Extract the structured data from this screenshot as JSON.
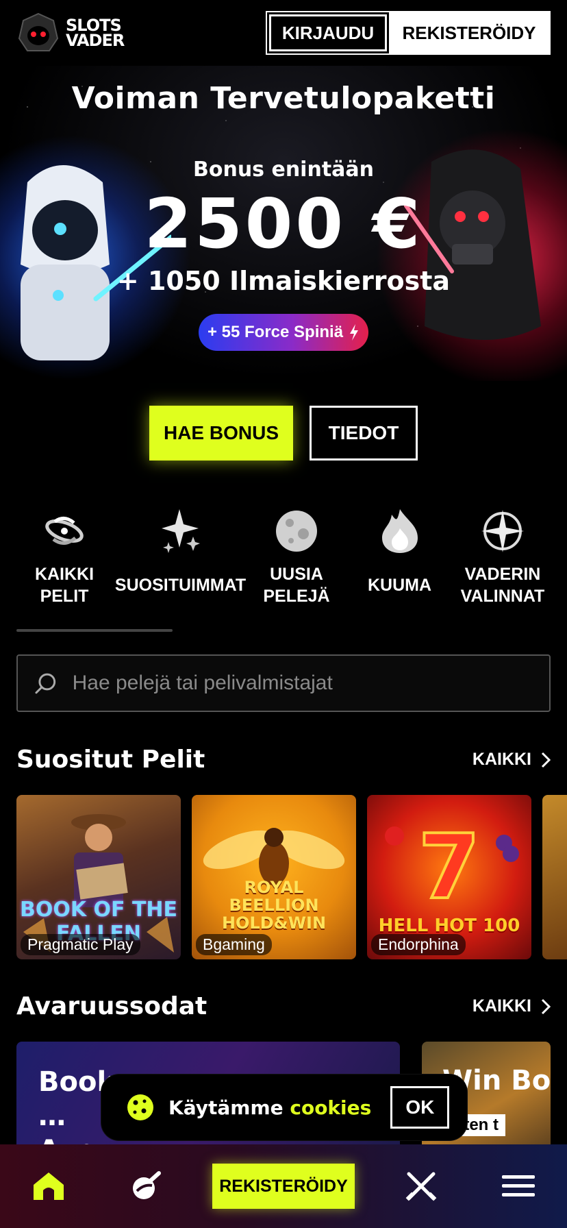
{
  "header": {
    "logo_line1": "SLOTS",
    "logo_line2": "VADER",
    "login_label": "KIRJAUDU",
    "register_label": "REKISTERÖIDY"
  },
  "hero": {
    "title": "Voiman Tervetulopaketti",
    "subtitle": "Bonus enintään",
    "amount": "2500 €",
    "spins": "+ 1050 Ilmaiskierrosta",
    "force_spins": "+ 55 Force Spiniä"
  },
  "cta": {
    "bonus_label": "HAE BONUS",
    "info_label": "TIEDOT"
  },
  "categories": [
    {
      "label": "KAIKKI PELIT",
      "icon": "galaxy-icon"
    },
    {
      "label": "SUOSITUIMMAT",
      "icon": "sparkle-icon"
    },
    {
      "label": "UUSIA PELEJÄ",
      "icon": "moon-icon"
    },
    {
      "label": "KUUMA",
      "icon": "flame-icon"
    },
    {
      "label": "VADERIN VALINNAT",
      "icon": "compass-star-icon"
    }
  ],
  "search": {
    "placeholder": "Hae pelejä tai pelivalmistajat"
  },
  "popular": {
    "title": "Suositut Pelit",
    "all_label": "KAIKKI",
    "games": [
      {
        "title": "BOOK OF THE FALLEN",
        "provider": "Pragmatic Play"
      },
      {
        "title": "ROYAL BEELLION HOLD&WIN",
        "provider": "Bgaming"
      },
      {
        "title": "HELL HOT 100",
        "provider": "Endorphina"
      }
    ]
  },
  "space_wars": {
    "title": "Avaruussodat",
    "all_label": "KAIKKI",
    "games": [
      {
        "title_visible": "Book … Augu…"
      },
      {
        "title_visible": "Win Boo…",
        "tag": "olten t"
      }
    ]
  },
  "cookie": {
    "text_prefix": "Käytämme",
    "text_highlight": "cookies",
    "ok_label": "OK"
  },
  "bottom_nav": {
    "register_label": "REKISTERÖIDY"
  },
  "colors": {
    "accent": "#dfff1e",
    "background": "#000000",
    "blue_glow": "#2b6dff",
    "red_glow": "#ff2850"
  }
}
